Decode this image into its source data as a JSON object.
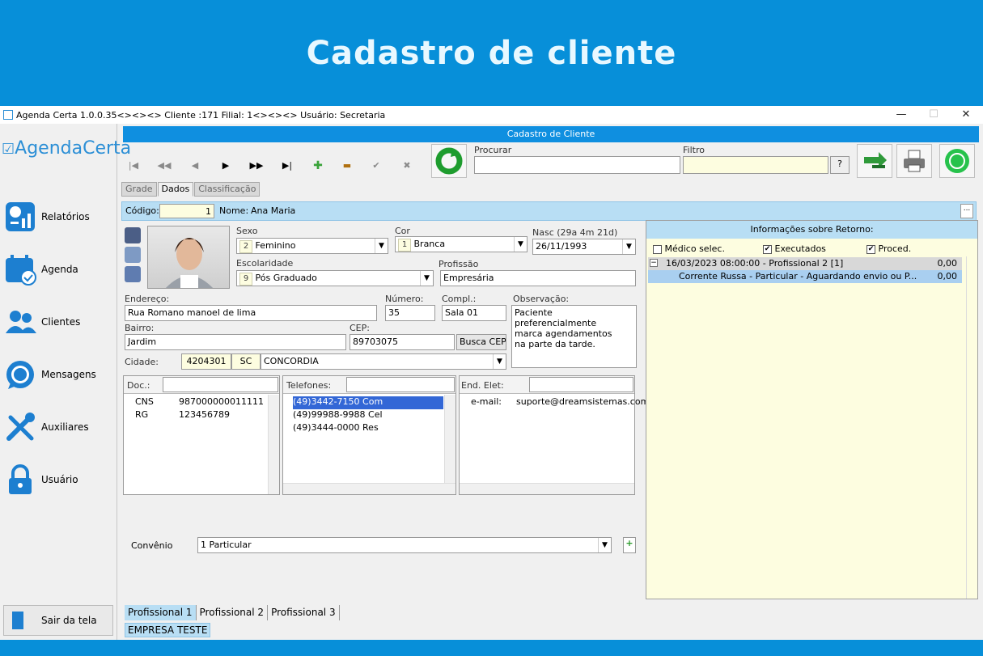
{
  "banner": {
    "title": "Cadastro de cliente"
  },
  "window": {
    "title": "Agenda Certa 1.0.0.35<><><> Cliente :171 Filial: 1<><><> Usuário: Secretaria",
    "minimize": "—",
    "maximize": "☐",
    "close": "✕"
  },
  "sidebar": {
    "logo": "AgendaCerta",
    "items": [
      {
        "label": "Relatórios",
        "icon": "report-icon"
      },
      {
        "label": "Agenda",
        "icon": "calendar-icon"
      },
      {
        "label": "Clientes",
        "icon": "users-icon"
      },
      {
        "label": "Mensagens",
        "icon": "whatsapp-icon"
      },
      {
        "label": "Auxiliares",
        "icon": "tools-icon"
      },
      {
        "label": "Usuário",
        "icon": "lock-icon"
      }
    ],
    "exit_label": "Sair da tela"
  },
  "header": {
    "title": "Cadastro de Cliente"
  },
  "toolbar": {
    "first": "|◀",
    "prev_page": "◀◀",
    "prev": "◀",
    "next": "▶",
    "next_page": "▶▶",
    "last": "▶|",
    "add": "✚",
    "remove": "▬",
    "confirm": "✔",
    "cancel": "✖"
  },
  "search": {
    "procurar_label": "Procurar",
    "procurar_value": "",
    "filtro_label": "Filtro",
    "filtro_value": "",
    "help": "?"
  },
  "tabs": [
    "Grade",
    "Dados",
    "Classificação"
  ],
  "record": {
    "codigo_label": "Código:",
    "codigo": "1",
    "nome_label": "Nome:",
    "nome": "Ana Maria",
    "ellipsis": "..."
  },
  "form": {
    "sexo_label": "Sexo",
    "sexo_code": "2",
    "sexo": "Feminino",
    "cor_label": "Cor",
    "cor_code": "1",
    "cor": "Branca",
    "nasc_label": "Nasc (29a 4m 21d)",
    "nasc": "26/11/1993",
    "escolaridade_label": "Escolaridade",
    "escolaridade_code": "9",
    "escolaridade": "Pós Graduado",
    "profissao_label": "Profissão",
    "profissao": "Empresária",
    "endereco_label": "Endereço:",
    "endereco": "Rua Romano manoel de lima",
    "numero_label": "Número:",
    "numero": "35",
    "compl_label": "Compl.:",
    "compl": "Sala 01",
    "obs_label": "Observação:",
    "obs": "Paciente preferencialmente marca agendamentos na parte da tarde.",
    "bairro_label": "Bairro:",
    "bairro": "Jardim",
    "cep_label": "CEP:",
    "cep": "89703075",
    "busca_cep": "Busca CEP",
    "cidade_label": "Cidade:",
    "cidade_code": "4204301",
    "uf": "SC",
    "cidade": "CONCORDIA",
    "convenio_label": "Convênio",
    "convenio_code": "1",
    "convenio": "Particular"
  },
  "docs": {
    "label": "Doc.:",
    "rows": [
      {
        "type": "CNS",
        "value": "987000000011111"
      },
      {
        "type": "RG",
        "value": "123456789"
      }
    ]
  },
  "phones": {
    "label": "Telefones:",
    "rows": [
      "(49)3442-7150 Com",
      "(49)99988-9988 Cel",
      "(49)3444-0000 Res"
    ]
  },
  "emails": {
    "label": "End. Elet:",
    "rows": [
      {
        "type": "e-mail:",
        "value": "suporte@dreamsistemas.com"
      }
    ]
  },
  "retorno": {
    "title": "Informações sobre Retorno:",
    "filters": [
      "Médico selec.",
      "Executados",
      "Proced."
    ],
    "filters_checked": [
      false,
      true,
      true
    ],
    "entries": [
      {
        "text": "16/03/2023 08:00:00 - Profissional 2 [1]",
        "value": "0,00"
      },
      {
        "text": "Corrente Russa - Particular - Aguardando envio ou P...",
        "value": "0,00"
      }
    ]
  },
  "bottom_tabs": [
    "Profissional 1",
    "Profissional 2",
    "Profissional 3"
  ],
  "status": "EMPRESA TESTE"
}
